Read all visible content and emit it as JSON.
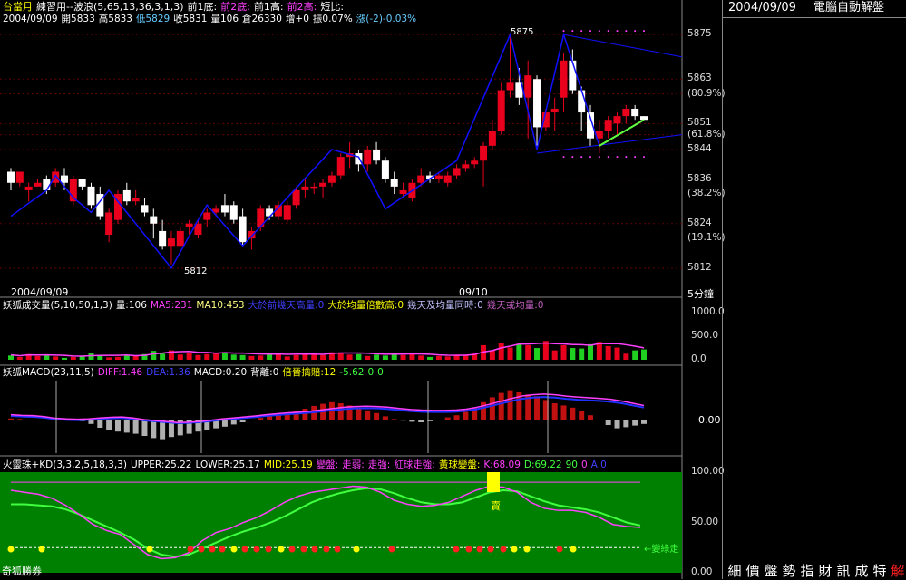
{
  "header": {
    "row1": {
      "symbol": "台當月",
      "study": "練習用--波浪(5,65,13,36,3,1,3)",
      "prev_low1": "前1底:",
      "prev_low2": "前2底:",
      "prev_high1": "前1高:",
      "prev_high2": "前2高:",
      "short_ratio": "短比:"
    },
    "row2": {
      "date": "2004/09/09",
      "open": "開5833",
      "high": "高5833",
      "low": "低5829",
      "close": "收5831",
      "volume": "量106",
      "oi": "倉26330",
      "change": "增+0",
      "amplitude": "振0.07%",
      "updown": "漲(-2)-0.03%"
    }
  },
  "price_panel": {
    "left_date": "2004/09/09",
    "mid_date": "09/10",
    "timeframe": "5分鐘",
    "high_label": "5875",
    "low_label": "5812",
    "axis_labels": [
      {
        "text": "5875",
        "y": 5875
      },
      {
        "text": "5863",
        "y": 5863
      },
      {
        "text": "(80.9%)",
        "y": 5859
      },
      {
        "text": "5851",
        "y": 5851
      },
      {
        "text": "(61.8%)",
        "y": 5848
      },
      {
        "text": "5844",
        "y": 5844
      },
      {
        "text": "5836",
        "y": 5836
      },
      {
        "text": "(38.2%)",
        "y": 5832
      },
      {
        "text": "5824",
        "y": 5824
      },
      {
        "text": "(19.1%)",
        "y": 5820
      },
      {
        "text": "5812",
        "y": 5812
      }
    ]
  },
  "volume_panel": {
    "title": "妖狐成交量(5,10,50,1,3)",
    "vol": "量:106",
    "ma5": "MA5:231",
    "ma10": "MA10:453",
    "cond1": "大於前幾天高量:0",
    "cond2": "大於均量倍數高:0",
    "cond3": "幾天及均量同時:0",
    "cond4": "幾天或均量:0",
    "axis": [
      "1000.0",
      "500.0",
      "0.0"
    ]
  },
  "macd_panel": {
    "title": "妖狐MACD(23,11,5)",
    "diff": "DIFF:1.46",
    "dea": "DEA:1.36",
    "macd": "MACD:0.20",
    "div": "背離:0",
    "div2": "倍晉擒賠:12",
    "val": "-5.62",
    "z1": "0",
    "z2": "0",
    "axis": "0.00"
  },
  "kd_panel": {
    "title": "火靈珠+KD(3,3,2,5,18,3,3)",
    "upper": "UPPER:25.22",
    "lower": "LOWER:25.17",
    "mid": "MID:25.19",
    "s1": "變盤:",
    "s2": "走弱:",
    "s3": "走強:",
    "s4": "紅球走強:",
    "s5": "黃球變盤:",
    "k": "K:68.09",
    "d": "D:69.22",
    "v90": "90",
    "v0": "0",
    "a0": "A:0",
    "sell_mark": "賣",
    "right_note": "←變綠走",
    "axis": [
      "100.00",
      "50.00",
      "0.00"
    ]
  },
  "footer": {
    "brand": "奇狐勝券"
  },
  "right_panel": {
    "date": "2004/09/09",
    "title": "電腦自動解盤",
    "buttons": [
      "細",
      "價",
      "盤",
      "勢",
      "指",
      "財",
      "訊",
      "成",
      "特",
      "解"
    ]
  },
  "colors": {
    "up": "#e8001c",
    "down": "#ffffff",
    "wave": "#1010ff",
    "kd_bg": "#008000"
  },
  "chart_data": {
    "type": "candlestick",
    "ylim": [
      5810,
      5877
    ],
    "candles": [
      [
        5838,
        5839,
        5833,
        5835
      ],
      [
        5835,
        5838,
        5834,
        5838
      ],
      [
        5833,
        5835,
        5830,
        5834
      ],
      [
        5834,
        5836,
        5834,
        5835
      ],
      [
        5836,
        5837,
        5832,
        5833
      ],
      [
        5835,
        5839,
        5834,
        5838
      ],
      [
        5837,
        5839,
        5833,
        5835
      ],
      [
        5830,
        5837,
        5829,
        5836
      ],
      [
        5836,
        5836,
        5833,
        5834
      ],
      [
        5834,
        5835,
        5828,
        5829
      ],
      [
        5832,
        5834,
        5825,
        5826
      ],
      [
        5821,
        5828,
        5819,
        5827
      ],
      [
        5825,
        5833,
        5824,
        5832
      ],
      [
        5833,
        5835,
        5829,
        5830
      ],
      [
        5830,
        5833,
        5829,
        5831
      ],
      [
        5829,
        5831,
        5826,
        5827
      ],
      [
        5826,
        5828,
        5820,
        5824
      ],
      [
        5822,
        5825,
        5817,
        5818
      ],
      [
        5818,
        5822,
        5813,
        5820
      ],
      [
        5818,
        5823,
        5818,
        5822
      ],
      [
        5823,
        5825,
        5821,
        5824
      ],
      [
        5821,
        5825,
        5820,
        5824
      ],
      [
        5825,
        5828,
        5823,
        5827
      ],
      [
        5827,
        5829,
        5826,
        5828
      ],
      [
        5829,
        5832,
        5826,
        5827
      ],
      [
        5829,
        5830,
        5824,
        5825
      ],
      [
        5826,
        5828,
        5818,
        5819
      ],
      [
        5820,
        5823,
        5817,
        5822
      ],
      [
        5823,
        5829,
        5822,
        5828
      ],
      [
        5828,
        5829,
        5825,
        5826
      ],
      [
        5826,
        5830,
        5825,
        5829
      ],
      [
        5825,
        5830,
        5824,
        5829
      ],
      [
        5829,
        5834,
        5828,
        5833
      ],
      [
        5833,
        5836,
        5831,
        5834
      ],
      [
        5834,
        5835,
        5832,
        5834
      ],
      [
        5834,
        5836,
        5831,
        5835
      ],
      [
        5835,
        5838,
        5834,
        5837
      ],
      [
        5837,
        5843,
        5836,
        5842
      ],
      [
        5842,
        5846,
        5839,
        5843
      ],
      [
        5843,
        5844,
        5838,
        5840
      ],
      [
        5840,
        5845,
        5838,
        5844
      ],
      [
        5844,
        5846,
        5840,
        5841
      ],
      [
        5841,
        5842,
        5835,
        5836
      ],
      [
        5836,
        5838,
        5832,
        5834
      ],
      [
        5832,
        5835,
        5831,
        5833
      ],
      [
        5831,
        5836,
        5830,
        5835
      ],
      [
        5835,
        5839,
        5834,
        5837
      ],
      [
        5837,
        5838,
        5835,
        5836
      ],
      [
        5836,
        5838,
        5835,
        5837
      ],
      [
        5835,
        5838,
        5834,
        5837
      ],
      [
        5837,
        5840,
        5836,
        5839
      ],
      [
        5839,
        5841,
        5838,
        5840
      ],
      [
        5840,
        5842,
        5839,
        5841
      ],
      [
        5841,
        5846,
        5834,
        5845
      ],
      [
        5845,
        5852,
        5844,
        5849
      ],
      [
        5849,
        5862,
        5848,
        5860
      ],
      [
        5860,
        5875,
        5858,
        5862
      ],
      [
        5862,
        5866,
        5856,
        5858
      ],
      [
        5858,
        5868,
        5847,
        5864
      ],
      [
        5863,
        5864,
        5845,
        5850
      ],
      [
        5850,
        5855,
        5849,
        5854
      ],
      [
        5854,
        5858,
        5849,
        5855
      ],
      [
        5858,
        5870,
        5854,
        5868
      ],
      [
        5868,
        5871,
        5859,
        5860
      ],
      [
        5860,
        5861,
        5849,
        5854
      ],
      [
        5854,
        5856,
        5845,
        5847
      ],
      [
        5847,
        5852,
        5843,
        5849
      ],
      [
        5849,
        5853,
        5847,
        5852
      ],
      [
        5851,
        5854,
        5848,
        5853
      ],
      [
        5853,
        5856,
        5851,
        5855
      ],
      [
        5855,
        5856,
        5852,
        5853
      ],
      [
        5853,
        5853,
        5852,
        5852
      ]
    ],
    "wave": [
      [
        0,
        5826
      ],
      [
        4,
        5833
      ],
      [
        5,
        5837
      ],
      [
        7,
        5831
      ],
      [
        9,
        5827
      ],
      [
        11,
        5833
      ],
      [
        18,
        5812
      ],
      [
        21,
        5825
      ],
      [
        22,
        5829
      ],
      [
        26,
        5818
      ],
      [
        36,
        5844
      ],
      [
        39,
        5842
      ],
      [
        42,
        5828
      ],
      [
        50,
        5841
      ],
      [
        56,
        5875
      ],
      [
        59,
        5844
      ],
      [
        62,
        5875
      ],
      [
        66,
        5845
      ]
    ],
    "volume": [
      90,
      60,
      120,
      80,
      100,
      70,
      40,
      60,
      70,
      140,
      90,
      50,
      60,
      100,
      80,
      120,
      190,
      130,
      200,
      110,
      150,
      100,
      120,
      130,
      160,
      110,
      100,
      80,
      90,
      140,
      120,
      70,
      100,
      110,
      120,
      100,
      160,
      140,
      110,
      120,
      80,
      110,
      90,
      140,
      100,
      120,
      90,
      60,
      80,
      70,
      110,
      100,
      130,
      310,
      200,
      360,
      260,
      330,
      310,
      250,
      400,
      200,
      310,
      250,
      240,
      330,
      380,
      290,
      260,
      130,
      200,
      220
    ],
    "macd": [
      0.2,
      0.1,
      0,
      -0.1,
      -0.1,
      0,
      0.1,
      0,
      -0.3,
      -0.8,
      -1.5,
      -2.0,
      -2.2,
      -2.4,
      -2.6,
      -3,
      -3.4,
      -3.6,
      -3.2,
      -2.9,
      -2.6,
      -2.2,
      -2.0,
      -1.6,
      -1.3,
      -0.9,
      -0.5,
      -0.1,
      0.3,
      0.6,
      1.0,
      1.3,
      1.6,
      2.0,
      2.5,
      2.9,
      3.2,
      3.0,
      2.6,
      2.2,
      1.7,
      1.2,
      0.6,
      0.1,
      -0.2,
      -0.4,
      -0.5,
      -0.3,
      0.0,
      0.4,
      0.8,
      1.4,
      2.2,
      3.2,
      4.1,
      4.9,
      5.4,
      5.0,
      4.6,
      4.3,
      3.6,
      3.0,
      2.6,
      2.2,
      1.6,
      0.8,
      0.0,
      -1.0,
      -1.6,
      -1.4,
      -1.1,
      -0.8
    ],
    "diff": [
      1.5,
      1.3,
      1.2,
      0.9,
      0.4,
      0.2,
      0.1,
      0.2,
      0.5,
      0.7,
      0.8,
      0.5,
      0.0,
      -0.3,
      -0.6,
      -0.9,
      -0.8,
      -0.6,
      -0.2,
      0.2,
      0.5,
      0.8,
      1.1,
      1.5,
      1.8,
      2.1,
      2.3,
      2.6,
      3.0,
      3.4,
      3.8,
      4.0,
      4.1,
      4.0,
      3.8,
      3.4,
      3.1,
      2.9,
      2.8,
      2.8,
      2.9,
      3.2,
      3.8,
      4.6,
      5.5,
      6.4,
      7.2,
      7.6,
      7.8,
      7.6,
      7.2,
      6.9,
      6.7,
      6.5,
      6.2,
      5.7,
      5.0,
      4.3
    ],
    "kd_k": [
      82,
      80,
      78,
      74,
      67,
      58,
      48,
      42,
      38,
      28,
      18,
      14,
      15,
      20,
      32,
      40,
      44,
      50,
      55,
      62,
      70,
      76,
      80,
      82,
      84,
      86,
      85,
      80,
      72,
      68,
      66,
      67,
      70,
      76,
      82,
      86,
      85,
      80,
      70,
      64,
      62,
      62,
      60,
      55,
      48,
      46,
      45
    ],
    "kd_d": [
      68,
      68,
      67,
      66,
      63,
      58,
      52,
      46,
      40,
      33,
      24,
      18,
      16,
      18,
      24,
      30,
      36,
      41,
      45,
      50,
      56,
      63,
      70,
      75,
      79,
      82,
      84,
      83,
      79,
      74,
      70,
      68,
      68,
      70,
      75,
      80,
      82,
      81,
      76,
      71,
      67,
      65,
      63,
      60,
      55,
      50,
      47
    ]
  }
}
